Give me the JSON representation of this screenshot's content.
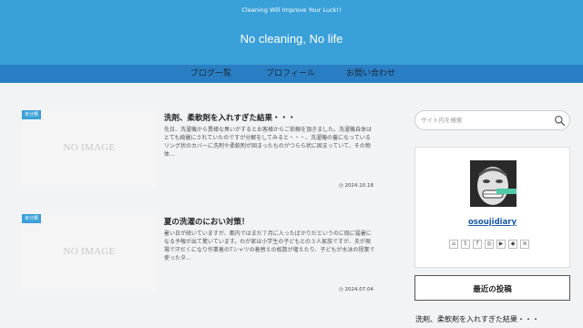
{
  "header": {
    "tagline": "Cleaning Will Improve Your Luck!!",
    "site_title": "No cleaning, No life"
  },
  "nav": {
    "items": [
      {
        "label": "ブログ一覧"
      },
      {
        "label": "プロフィール"
      },
      {
        "label": "お問い合わせ"
      }
    ]
  },
  "posts": [
    {
      "category": "未分類",
      "thumb_text": "NO IMAGE",
      "title": "洗剤、柔軟剤を入れすぎた結果・・・",
      "excerpt": "先日、洗濯機から異様な臭いがするとお客様からご依頼を頂きました。洗濯機自体はとても綺麗にされていたのですが分解をしてみると・・・、洗濯機の蓋になっているリング状のカバーに洗剤や柔軟剤が固まったものがつらら状に固まっていて、その物体...",
      "date": "2024.10.18"
    },
    {
      "category": "未分類",
      "thumb_text": "NO IMAGE",
      "title": "夏の洗濯のにおい対策！",
      "excerpt": "暑い日が続いていますが、都内ではまだ７月に入ったばかりだというのに既に猛暑になる予報が出て驚いています。わが家は小学生の子どもとの３人家族ですが、夫が現場で汗だくになり作業着のTシャツの着替えの枚数が増えたり、子どもが水泳の授業で使ったタ...",
      "date": "2024.07.04"
    }
  ],
  "sidebar": {
    "search_placeholder": "サイト内を検索",
    "profile_name": "osoujidiary",
    "sns_icons": [
      "home-icon",
      "twitter-icon",
      "facebook-icon",
      "instagram-icon",
      "youtube-icon",
      "feedly-icon",
      "rss-icon"
    ],
    "recent_label": "最近の投稿",
    "recent_items": [
      "洗剤、柔軟剤を入れすぎた結果・・・"
    ]
  },
  "colors": {
    "header_bg": "#3aa0d9",
    "nav_bg": "#2a7fc4",
    "category_bg": "#3aa0d9",
    "link": "#1a5aa8"
  }
}
